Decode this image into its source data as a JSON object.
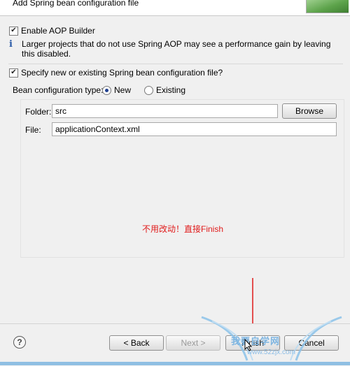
{
  "header": {
    "title": "Add Spring bean configuration file"
  },
  "aop": {
    "checkbox_label": "Enable AOP Builder",
    "checked": true,
    "info": "Larger projects that do not use Spring AOP may see a performance gain by leaving this disabled."
  },
  "specify": {
    "checkbox_label": "Specify new or existing Spring bean configuration file?",
    "checked": true
  },
  "bean_type": {
    "label": "Bean configuration type:",
    "options": [
      "New",
      "Existing"
    ],
    "selected": "New"
  },
  "folder": {
    "label": "Folder:",
    "value": "src",
    "browse_label": "Browse"
  },
  "file": {
    "label": "File:",
    "value": "applicationContext.xml"
  },
  "annotation": "不用改动！直接Finish",
  "footer": {
    "help": "?",
    "back_label": "< Back",
    "next_label": "Next >",
    "finish_label": "Finish",
    "cancel_label": "Cancel"
  },
  "watermark": {
    "text": "我要自学网",
    "url": "www.52zjx.com"
  },
  "colors": {
    "annotation": "#e01b1b",
    "arrow": "#e01b1b",
    "radio_selected": "#1f3f8f"
  }
}
